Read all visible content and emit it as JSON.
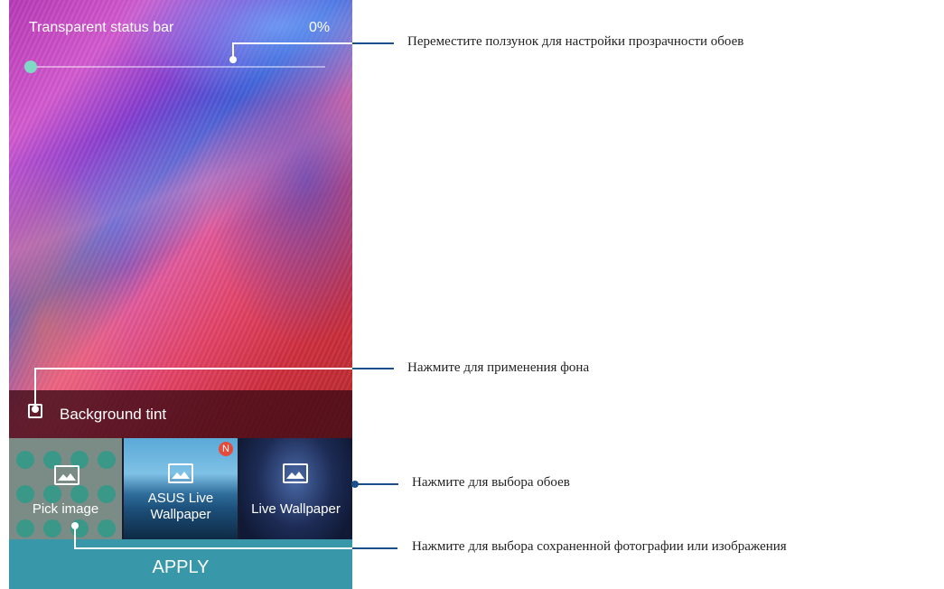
{
  "status_bar": {
    "label": "Transparent status bar",
    "percent": "0%"
  },
  "slider": {
    "value_percent": 0
  },
  "background_tint": {
    "label": "Background tint",
    "checked": false
  },
  "thumbnails": [
    {
      "label": "Pick image",
      "icon": "image-icon"
    },
    {
      "label": "ASUS Live Wallpaper",
      "icon": "image-loading-icon",
      "badge": "N"
    },
    {
      "label": "Live Wallpaper",
      "icon": "image-loading-icon"
    }
  ],
  "apply": {
    "label": "APPLY"
  },
  "callouts": [
    "Переместите ползунок для настройки прозрачности обоев",
    "Нажмите для применения фона",
    "Нажмите для выбора обоев",
    "Нажмите для выбора сохраненной фотографии или изображения"
  ],
  "colors": {
    "accent": "#3897a8",
    "callout_line": "#1a4f8a",
    "slider_thumb": "#7fd9c4",
    "badge": "#e64a3c"
  }
}
